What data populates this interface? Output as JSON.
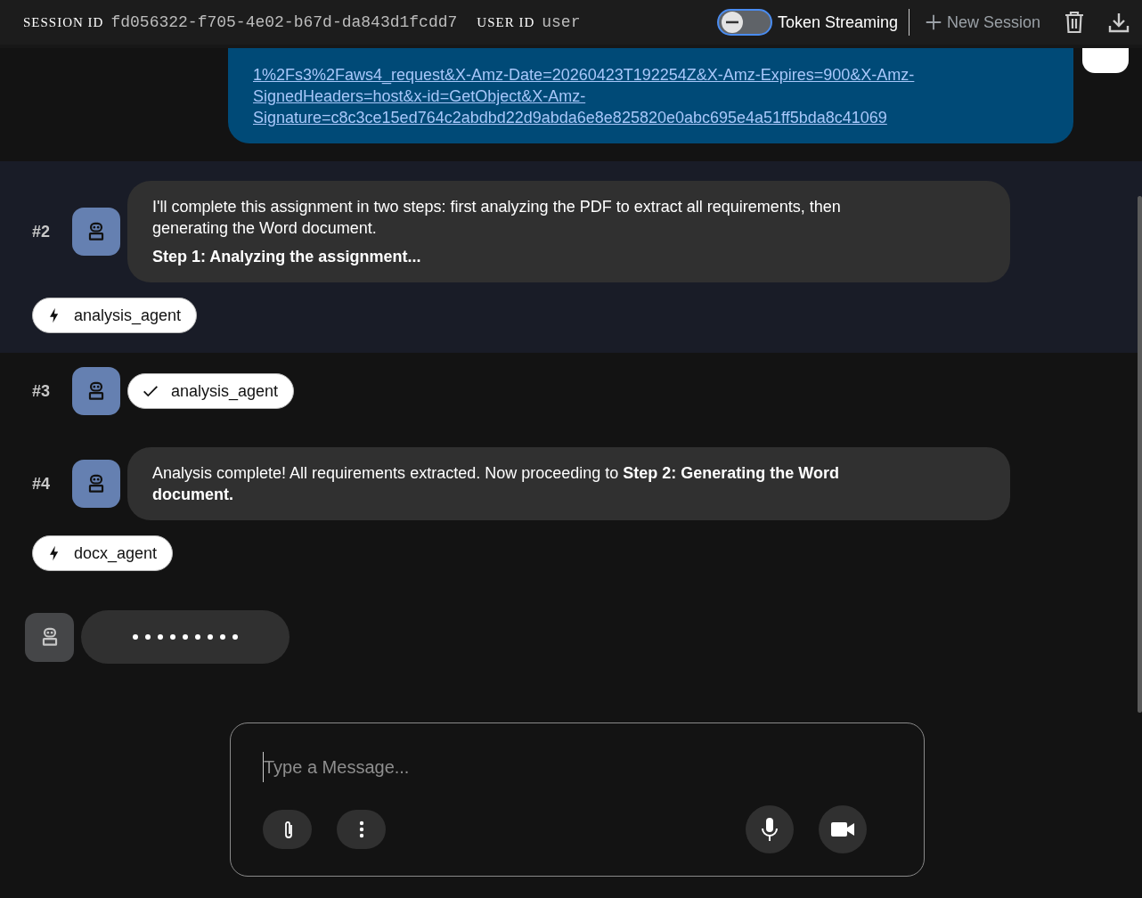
{
  "header": {
    "session_label": "SESSION ID",
    "session_id": "fd056322-f705-4e02-b67d-da843d1fcdd7",
    "user_label": "USER ID",
    "user_id": "user",
    "toggle": {
      "label": "Token Streaming",
      "on": false
    },
    "new_session": "New Session"
  },
  "messages": [
    {
      "kind": "user",
      "link_lines": [
        "1%2Fs3%2Faws4_request&X-Amz-Date=20260423T192254Z&X-Amz-Expires=900&X-Amz-",
        "SignedHeaders=host&x-id=GetObject&X-Amz-",
        "Signature=c8c3ce15ed764c2abdbd22d9abda6e8e825820e0abc695e4a51ff5bda8c41069"
      ]
    },
    {
      "kind": "agent",
      "index": "#2",
      "highlighted": true,
      "paragraphs": [
        "I'll complete this assignment in two steps: first analyzing the PDF to extract all requirements, then generating the Word document.",
        "**Step 1: Analyzing the assignment...**"
      ],
      "chips": [
        {
          "kind": "running",
          "label": "analysis_agent"
        }
      ]
    },
    {
      "kind": "agent",
      "index": "#3",
      "highlighted": false,
      "inline_chip": {
        "kind": "done",
        "label": "analysis_agent"
      }
    },
    {
      "kind": "agent",
      "index": "#4",
      "highlighted": false,
      "paragraphs": [
        "Analysis complete! All requirements extracted. Now proceeding to **Step 2: Generating the Word document.**"
      ],
      "chips": [
        {
          "kind": "running",
          "label": "docx_agent"
        }
      ]
    },
    {
      "kind": "loading"
    }
  ],
  "composer": {
    "placeholder": "Type a Message..."
  }
}
